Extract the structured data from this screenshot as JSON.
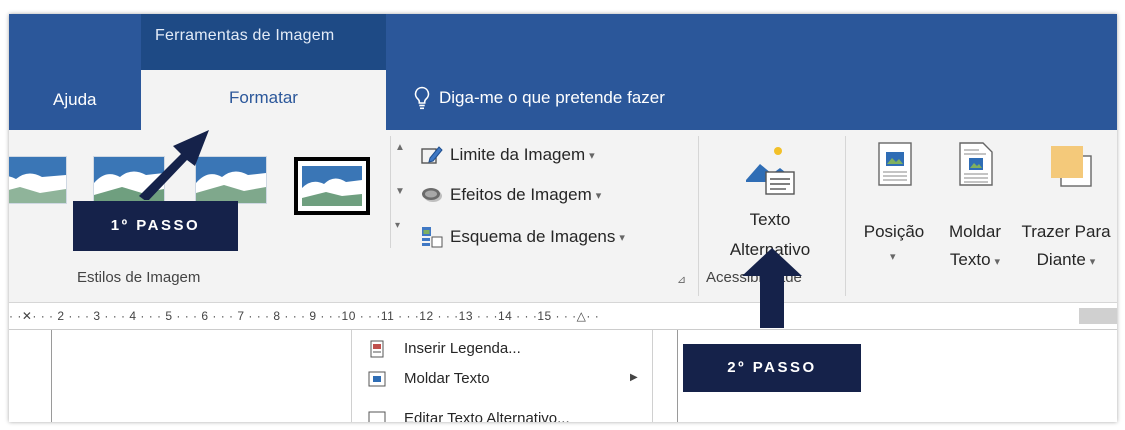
{
  "tabs": {
    "context_group": "Ferramentas de Imagem",
    "ajuda": "Ajuda",
    "formatar": "Formatar",
    "tell_me": "Diga-me o que pretende fazer"
  },
  "ribbon": {
    "picture_border": "Limite da Imagem",
    "picture_effects": "Efeitos de Imagem",
    "picture_layout": "Esquema de Imagens",
    "styles_group_label": "Estilos de Imagem",
    "alt_text_line1": "Texto",
    "alt_text_line2": "Alternativo",
    "accessibility_label": "Acessibilidade",
    "position_label": "Posição",
    "wrap_line1": "Moldar",
    "wrap_line2": "Texto",
    "bring_line1": "Trazer Para",
    "bring_line2": "Diante"
  },
  "ruler": {
    "text": "· ·✕· · · 2 · · · 3 · · · 4 · · · 5 · · · 6 · · · 7 · · · 8 · · · 9 · · ·10 · · ·11 · · ·12 · · ·13 · · ·14 · · ·15 · · ·△· ·"
  },
  "context_menu": {
    "insert_caption": "Inserir Legenda...",
    "wrap_text": "Moldar Texto",
    "edit_alt_text": "Editar Texto Alternativo..."
  },
  "callouts": {
    "step1": "1º PASSO",
    "step2": "2º PASSO"
  },
  "colors": {
    "title_blue": "#2b579a",
    "context_blue": "#1e4a85",
    "callout_navy": "#15224a",
    "ribbon_bg": "#f3f3f3"
  },
  "icons": [
    "lightbulb-icon",
    "pen-icon",
    "effects-icon",
    "layout-icon",
    "alt-text-icon",
    "position-icon",
    "wrap-text-icon",
    "bring-forward-icon",
    "caption-icon",
    "dropdown-arrow-icon",
    "submenu-arrow-icon",
    "dialog-launcher-icon"
  ]
}
